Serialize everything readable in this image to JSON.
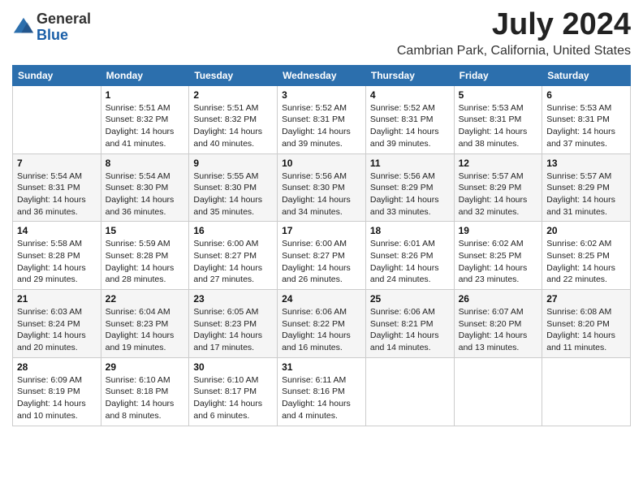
{
  "header": {
    "logo_line1": "General",
    "logo_line2": "Blue",
    "month": "July 2024",
    "location": "Cambrian Park, California, United States"
  },
  "weekdays": [
    "Sunday",
    "Monday",
    "Tuesday",
    "Wednesday",
    "Thursday",
    "Friday",
    "Saturday"
  ],
  "weeks": [
    [
      {
        "day": "",
        "info": ""
      },
      {
        "day": "1",
        "info": "Sunrise: 5:51 AM\nSunset: 8:32 PM\nDaylight: 14 hours\nand 41 minutes."
      },
      {
        "day": "2",
        "info": "Sunrise: 5:51 AM\nSunset: 8:32 PM\nDaylight: 14 hours\nand 40 minutes."
      },
      {
        "day": "3",
        "info": "Sunrise: 5:52 AM\nSunset: 8:31 PM\nDaylight: 14 hours\nand 39 minutes."
      },
      {
        "day": "4",
        "info": "Sunrise: 5:52 AM\nSunset: 8:31 PM\nDaylight: 14 hours\nand 39 minutes."
      },
      {
        "day": "5",
        "info": "Sunrise: 5:53 AM\nSunset: 8:31 PM\nDaylight: 14 hours\nand 38 minutes."
      },
      {
        "day": "6",
        "info": "Sunrise: 5:53 AM\nSunset: 8:31 PM\nDaylight: 14 hours\nand 37 minutes."
      }
    ],
    [
      {
        "day": "7",
        "info": "Sunrise: 5:54 AM\nSunset: 8:31 PM\nDaylight: 14 hours\nand 36 minutes."
      },
      {
        "day": "8",
        "info": "Sunrise: 5:54 AM\nSunset: 8:30 PM\nDaylight: 14 hours\nand 36 minutes."
      },
      {
        "day": "9",
        "info": "Sunrise: 5:55 AM\nSunset: 8:30 PM\nDaylight: 14 hours\nand 35 minutes."
      },
      {
        "day": "10",
        "info": "Sunrise: 5:56 AM\nSunset: 8:30 PM\nDaylight: 14 hours\nand 34 minutes."
      },
      {
        "day": "11",
        "info": "Sunrise: 5:56 AM\nSunset: 8:29 PM\nDaylight: 14 hours\nand 33 minutes."
      },
      {
        "day": "12",
        "info": "Sunrise: 5:57 AM\nSunset: 8:29 PM\nDaylight: 14 hours\nand 32 minutes."
      },
      {
        "day": "13",
        "info": "Sunrise: 5:57 AM\nSunset: 8:29 PM\nDaylight: 14 hours\nand 31 minutes."
      }
    ],
    [
      {
        "day": "14",
        "info": "Sunrise: 5:58 AM\nSunset: 8:28 PM\nDaylight: 14 hours\nand 29 minutes."
      },
      {
        "day": "15",
        "info": "Sunrise: 5:59 AM\nSunset: 8:28 PM\nDaylight: 14 hours\nand 28 minutes."
      },
      {
        "day": "16",
        "info": "Sunrise: 6:00 AM\nSunset: 8:27 PM\nDaylight: 14 hours\nand 27 minutes."
      },
      {
        "day": "17",
        "info": "Sunrise: 6:00 AM\nSunset: 8:27 PM\nDaylight: 14 hours\nand 26 minutes."
      },
      {
        "day": "18",
        "info": "Sunrise: 6:01 AM\nSunset: 8:26 PM\nDaylight: 14 hours\nand 24 minutes."
      },
      {
        "day": "19",
        "info": "Sunrise: 6:02 AM\nSunset: 8:25 PM\nDaylight: 14 hours\nand 23 minutes."
      },
      {
        "day": "20",
        "info": "Sunrise: 6:02 AM\nSunset: 8:25 PM\nDaylight: 14 hours\nand 22 minutes."
      }
    ],
    [
      {
        "day": "21",
        "info": "Sunrise: 6:03 AM\nSunset: 8:24 PM\nDaylight: 14 hours\nand 20 minutes."
      },
      {
        "day": "22",
        "info": "Sunrise: 6:04 AM\nSunset: 8:23 PM\nDaylight: 14 hours\nand 19 minutes."
      },
      {
        "day": "23",
        "info": "Sunrise: 6:05 AM\nSunset: 8:23 PM\nDaylight: 14 hours\nand 17 minutes."
      },
      {
        "day": "24",
        "info": "Sunrise: 6:06 AM\nSunset: 8:22 PM\nDaylight: 14 hours\nand 16 minutes."
      },
      {
        "day": "25",
        "info": "Sunrise: 6:06 AM\nSunset: 8:21 PM\nDaylight: 14 hours\nand 14 minutes."
      },
      {
        "day": "26",
        "info": "Sunrise: 6:07 AM\nSunset: 8:20 PM\nDaylight: 14 hours\nand 13 minutes."
      },
      {
        "day": "27",
        "info": "Sunrise: 6:08 AM\nSunset: 8:20 PM\nDaylight: 14 hours\nand 11 minutes."
      }
    ],
    [
      {
        "day": "28",
        "info": "Sunrise: 6:09 AM\nSunset: 8:19 PM\nDaylight: 14 hours\nand 10 minutes."
      },
      {
        "day": "29",
        "info": "Sunrise: 6:10 AM\nSunset: 8:18 PM\nDaylight: 14 hours\nand 8 minutes."
      },
      {
        "day": "30",
        "info": "Sunrise: 6:10 AM\nSunset: 8:17 PM\nDaylight: 14 hours\nand 6 minutes."
      },
      {
        "day": "31",
        "info": "Sunrise: 6:11 AM\nSunset: 8:16 PM\nDaylight: 14 hours\nand 4 minutes."
      },
      {
        "day": "",
        "info": ""
      },
      {
        "day": "",
        "info": ""
      },
      {
        "day": "",
        "info": ""
      }
    ]
  ]
}
